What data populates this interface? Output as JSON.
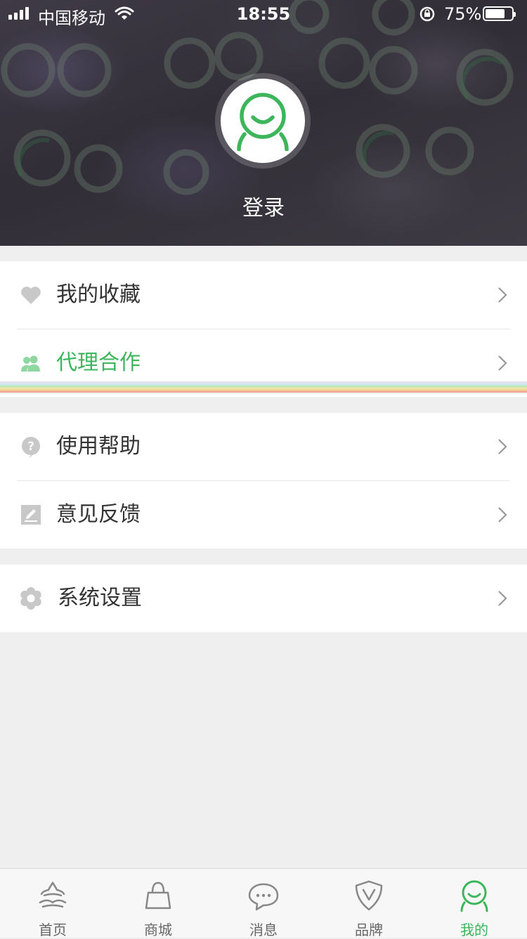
{
  "status_bar": {
    "carrier": "中国移动",
    "time": "18:55",
    "battery_percent": "75%",
    "battery_level": 0.75
  },
  "profile": {
    "login_label": "登录",
    "avatar_icon": "smiley-person-icon"
  },
  "menu": {
    "groups": [
      [
        {
          "label": "我的收藏",
          "icon": "heart-icon"
        },
        {
          "label": "代理合作",
          "icon": "users-icon",
          "highlight": true
        }
      ],
      [
        {
          "label": "使用帮助",
          "icon": "question-icon"
        },
        {
          "label": "意见反馈",
          "icon": "edit-icon"
        }
      ],
      [
        {
          "label": "系统设置",
          "icon": "gear-icon"
        }
      ]
    ]
  },
  "tabbar": {
    "tabs": [
      {
        "label": "首页",
        "icon": "home-icon"
      },
      {
        "label": "商城",
        "icon": "shopping-bag-icon"
      },
      {
        "label": "消息",
        "icon": "chat-bubble-icon"
      },
      {
        "label": "品牌",
        "icon": "brand-shield-icon"
      },
      {
        "label": "我的",
        "icon": "profile-icon",
        "active": true
      }
    ]
  },
  "colors": {
    "accent": "#3cb55b",
    "background": "#efefef",
    "icon_gray": "#c8c8c8"
  }
}
